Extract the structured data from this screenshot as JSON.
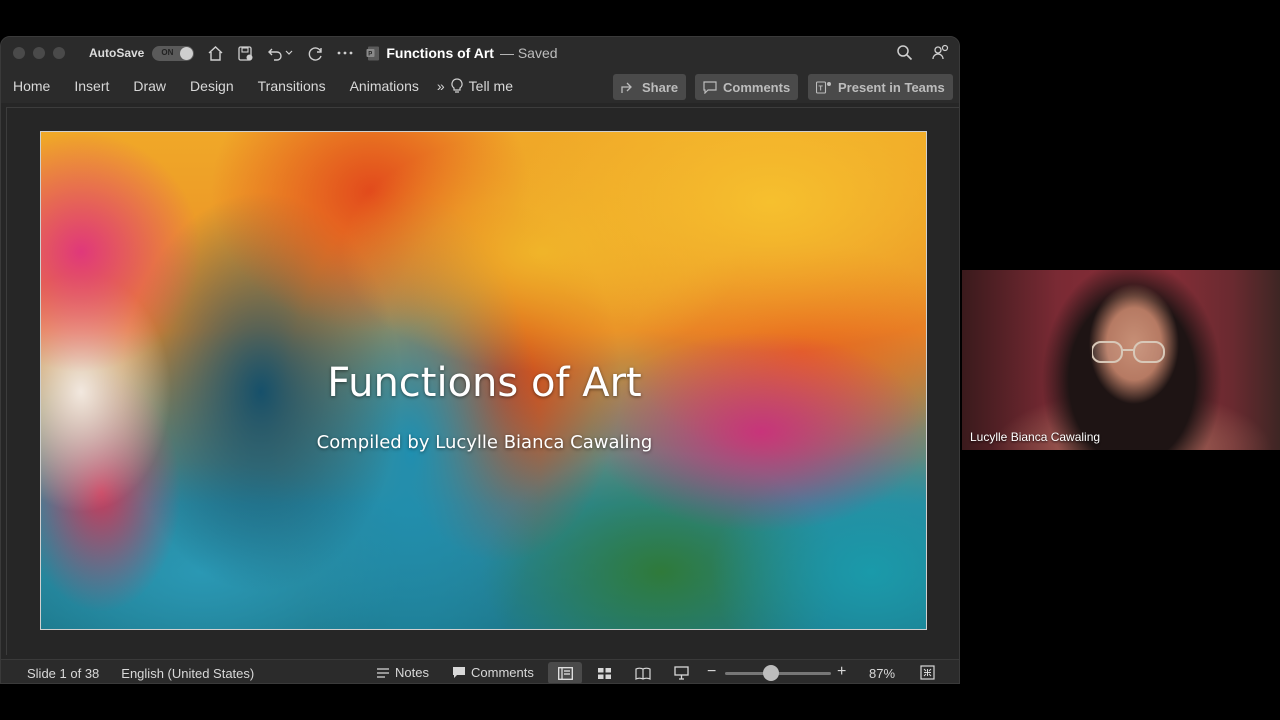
{
  "window": {
    "autosave_label": "AutoSave",
    "autosave_state": "ON",
    "doc_name": "Functions of Art",
    "doc_status": "— Saved"
  },
  "ribbon": {
    "tabs": [
      "Home",
      "Insert",
      "Draw",
      "Design",
      "Transitions",
      "Animations"
    ],
    "tell_me": "Tell me",
    "share": "Share",
    "comments": "Comments",
    "present_in_teams": "Present in Teams"
  },
  "slide": {
    "title": "Functions of Art",
    "subtitle": "Compiled by Lucylle Bianca Cawaling"
  },
  "status": {
    "slide_position": "Slide 1 of 38",
    "language": "English (United States)",
    "notes": "Notes",
    "comments": "Comments",
    "zoom": "87%"
  },
  "participant": {
    "name": "Lucylle Bianca Cawaling"
  },
  "icons": [
    "home-icon",
    "save-icon",
    "undo-icon",
    "redo-icon",
    "more-icon",
    "search-icon",
    "share-icon",
    "comment-icon",
    "teams-icon",
    "lightbulb-icon"
  ]
}
